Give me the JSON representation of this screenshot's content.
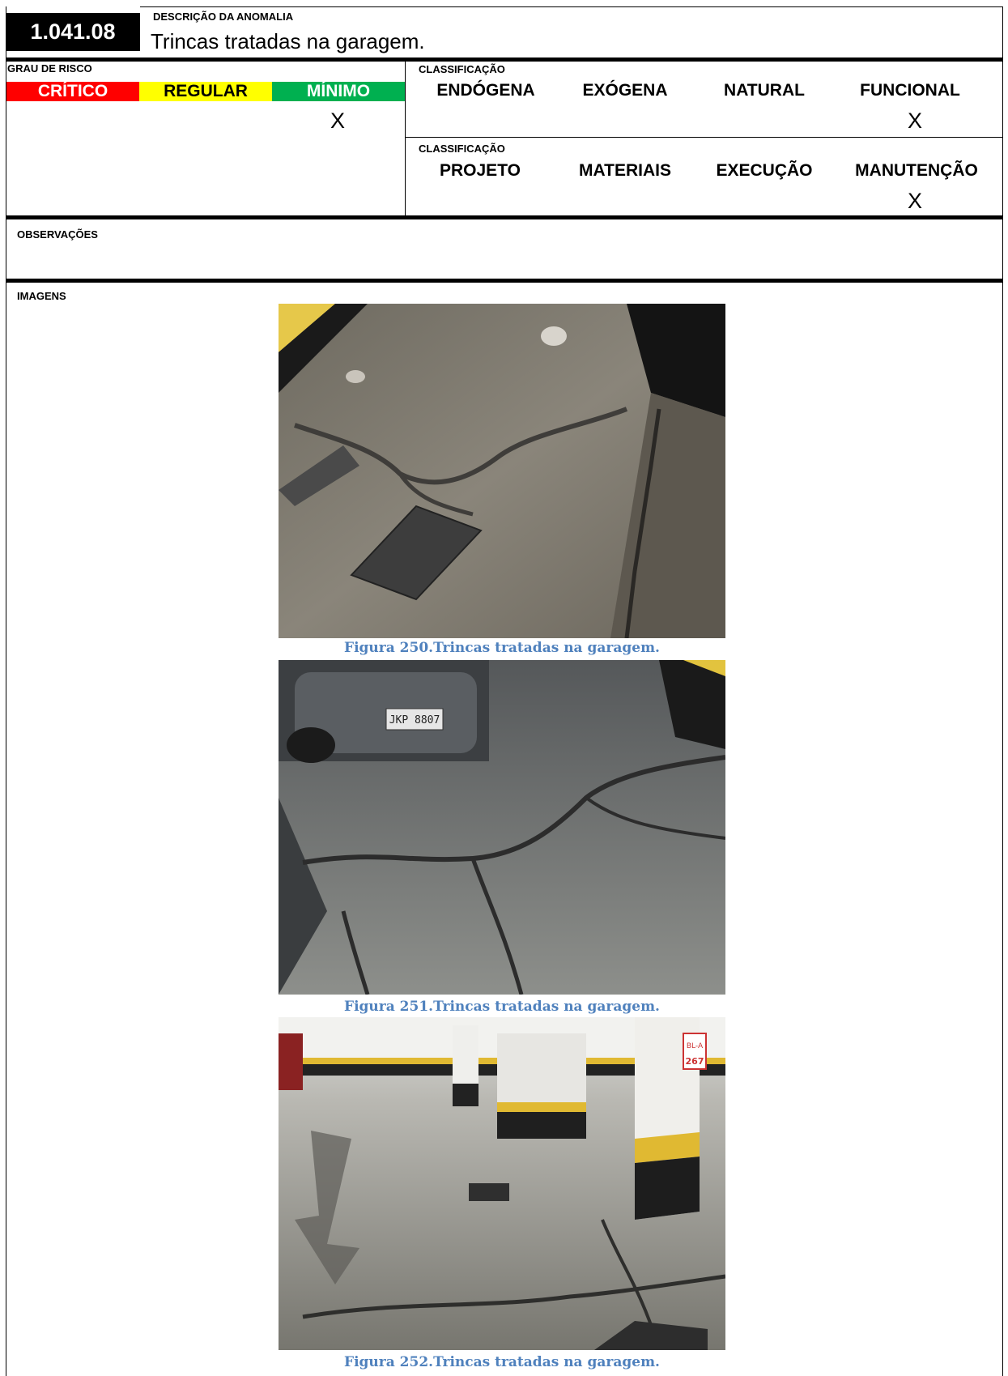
{
  "header": {
    "id": "1.041.08",
    "description_label": "DESCRIÇÃO DA ANOMALIA",
    "description": "Trincas tratadas na garagem."
  },
  "risk": {
    "label": "GRAU DE RISCO",
    "levels": [
      {
        "label": "CRÍTICO",
        "color": "#ff0000",
        "text_color": "#ffffff"
      },
      {
        "label": "REGULAR",
        "color": "#ffff00",
        "text_color": "#000000"
      },
      {
        "label": "MÍNIMO",
        "color": "#00b050",
        "text_color": "#ffffff"
      }
    ],
    "mark": "X"
  },
  "classification1": {
    "label": "CLASSIFICAÇÃO",
    "items": [
      "ENDÓGENA",
      "EXÓGENA",
      "NATURAL",
      "FUNCIONAL"
    ],
    "mark": "X"
  },
  "classification2": {
    "label": "CLASSIFICAÇÃO",
    "items": [
      "PROJETO",
      "MATERIAIS",
      "EXECUÇÃO",
      "MANUTENÇÃO"
    ],
    "mark": "X"
  },
  "observations": {
    "label": "OBSERVAÇÕES"
  },
  "images": {
    "label": "IMAGENS",
    "figures": [
      {
        "caption": "Figura 250.Trincas tratadas na garagem."
      },
      {
        "caption": "Figura 251.Trincas tratadas na garagem."
      },
      {
        "caption": "Figura 252.Trincas tratadas na garagem."
      }
    ]
  }
}
